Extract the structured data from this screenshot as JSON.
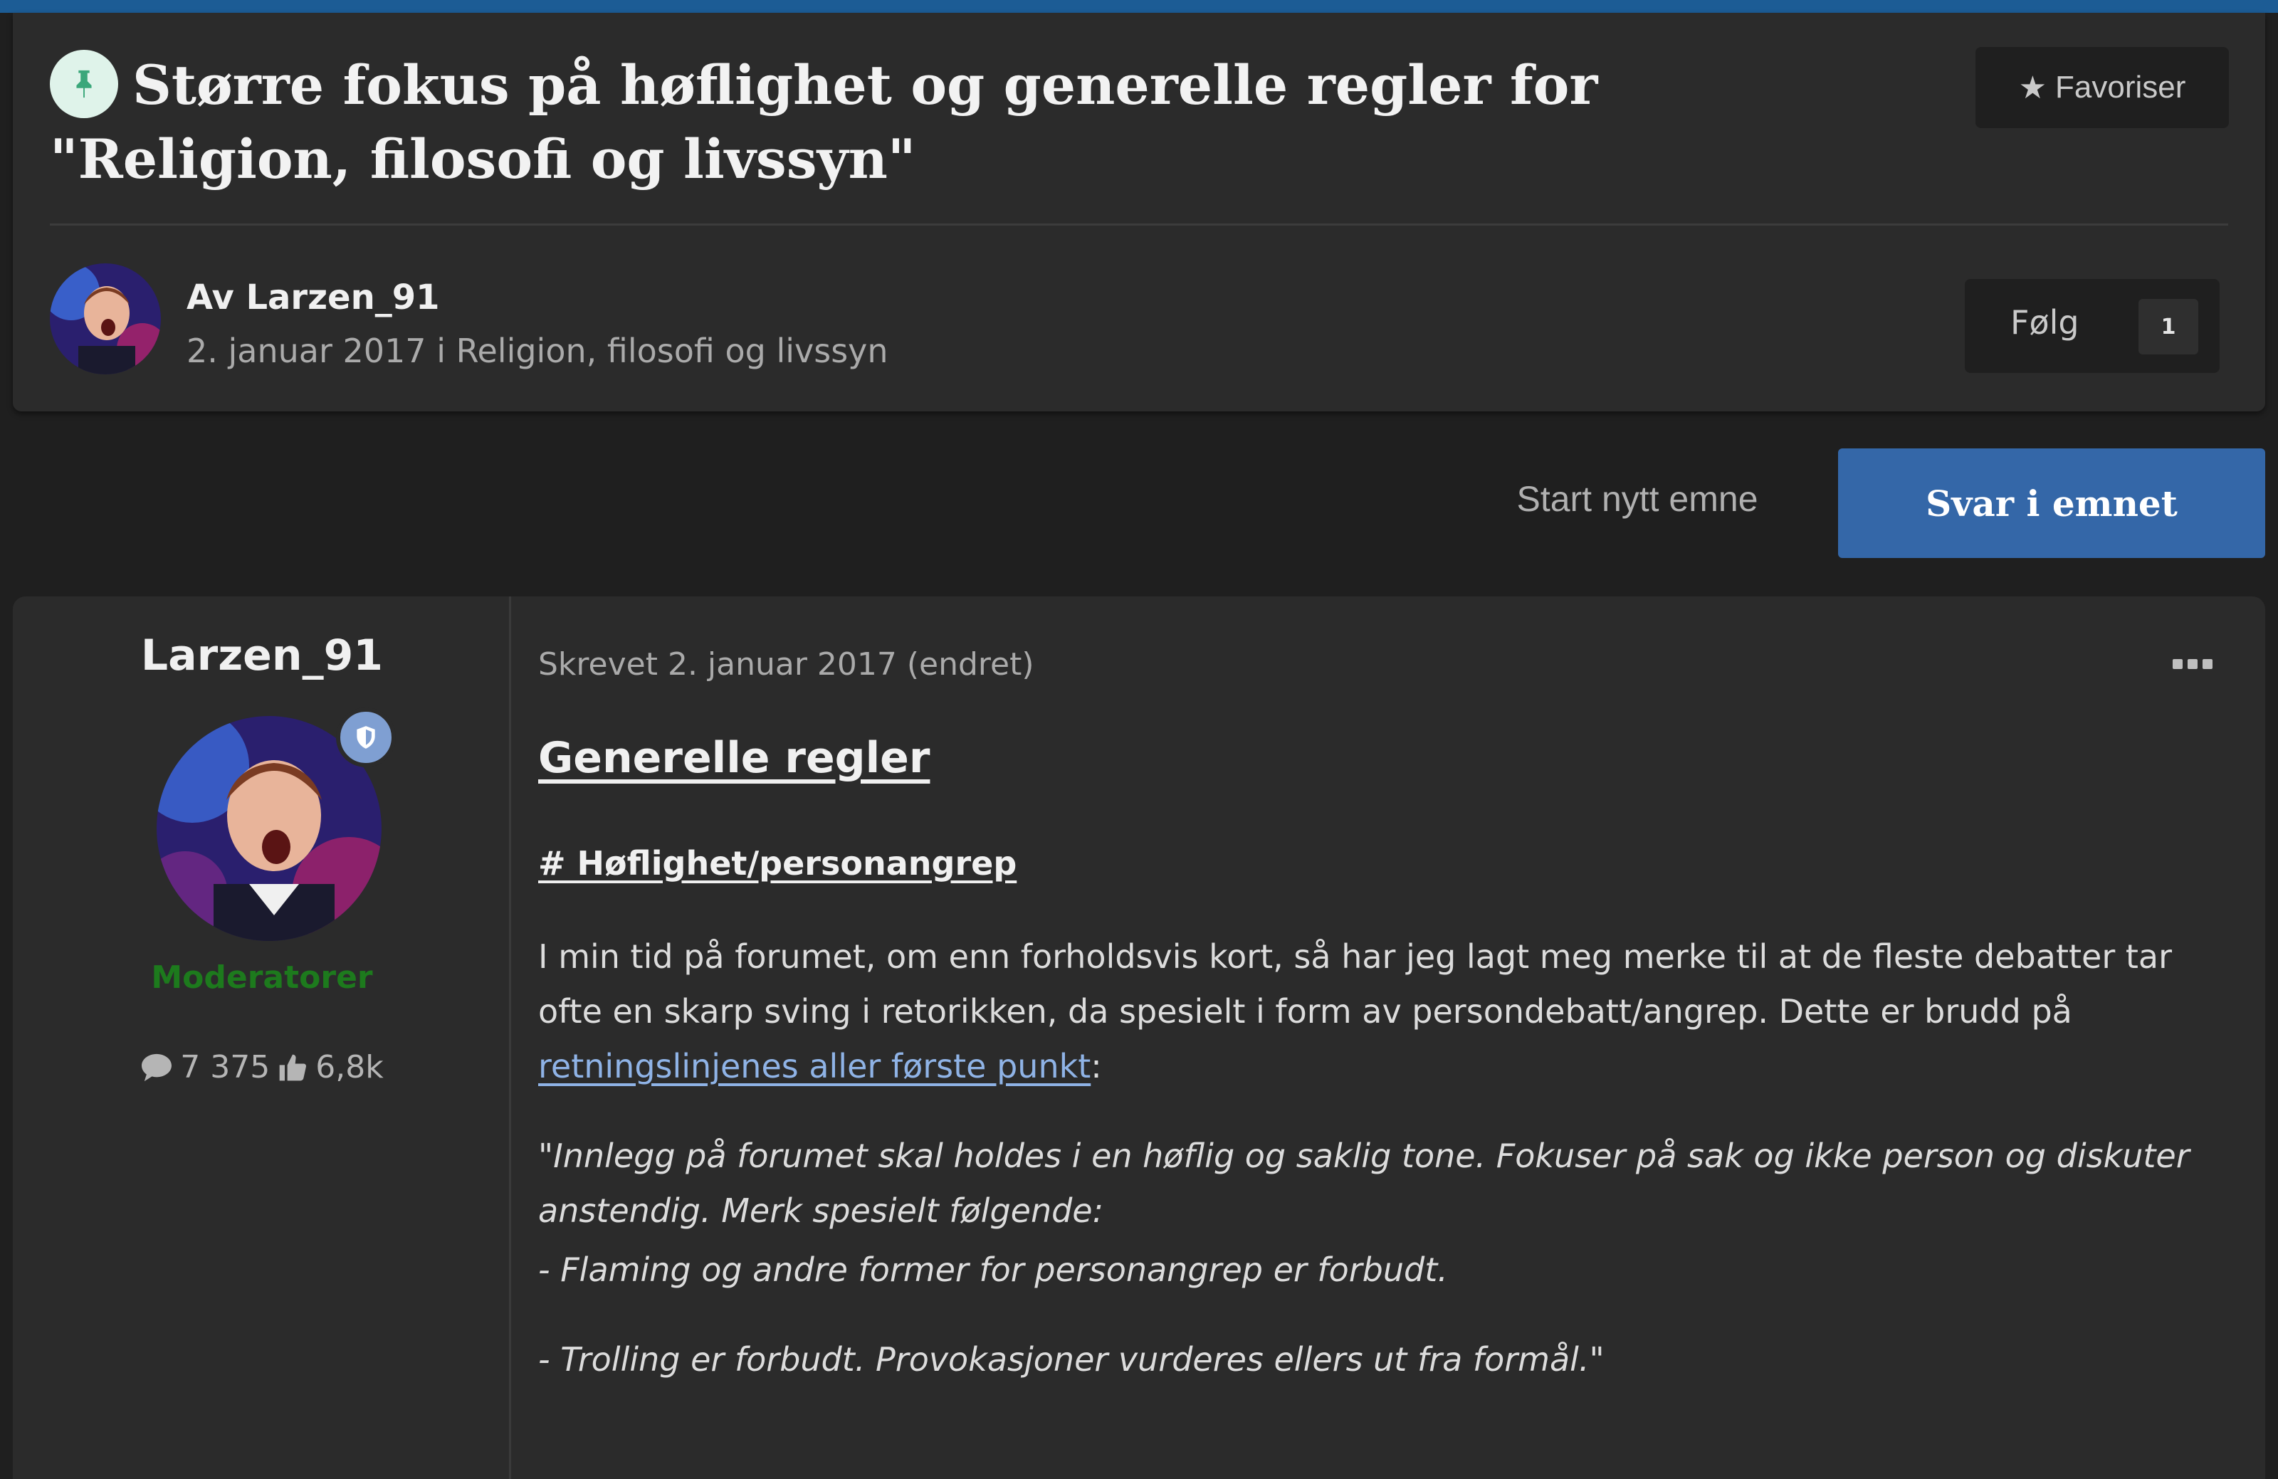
{
  "topic": {
    "title": "Større fokus på høflighet og generelle regler for \"Religion, filosofi og livssyn\"",
    "favorite_label": "Favoriser",
    "author_line": "Av Larzen_91",
    "meta_line": "2. januar 2017 i Religion, filosofi og livssyn",
    "follow_label": "Følg",
    "follow_count": "1"
  },
  "actions": {
    "start_topic": "Start nytt emne",
    "reply": "Svar i emnet"
  },
  "post": {
    "author": "Larzen_91",
    "group": "Moderatorer",
    "posts_count": "7 375",
    "reputation": "6,8k",
    "date": "Skrevet 2. januar 2017 (endret)",
    "heading": "Generelle regler",
    "subheading": "# Høflighet/personangrep",
    "paragraph_text": "I min tid på forumet, om enn forholdsvis kort, så har jeg lagt meg merke til at de fleste debatter tar ofte en skarp sving i retorikken, da spesielt i form av persondebatt/angrep. Dette er brudd på ",
    "link_text": "retningslinjenes aller første punkt",
    "paragraph_suffix": ":",
    "quote_1": "\"Innlegg på forumet skal holdes i en høflig og saklig tone. Fokuser på sak og ikke person og diskuter anstendig. Merk spesielt følgende:",
    "quote_2": "- Flaming og andre former for personangrep er forbudt.",
    "quote_3": "- Trolling er forbudt. Provokasjoner vurderes ellers ut fra formål.\""
  },
  "icons": {
    "pin": "pin-icon",
    "star": "star-icon",
    "shield": "shield-icon",
    "comment": "comment-icon",
    "thumbs_up": "thumbs-up-icon",
    "more": "more-horizontal-icon"
  },
  "colors": {
    "accent_blue": "#3467a8",
    "top_strip": "#1c5c95",
    "moderator_green": "#1d7a1d",
    "link": "#8fb3e6",
    "pin_badge_bg": "#dff3ea",
    "pin_color": "#3aa77a"
  }
}
